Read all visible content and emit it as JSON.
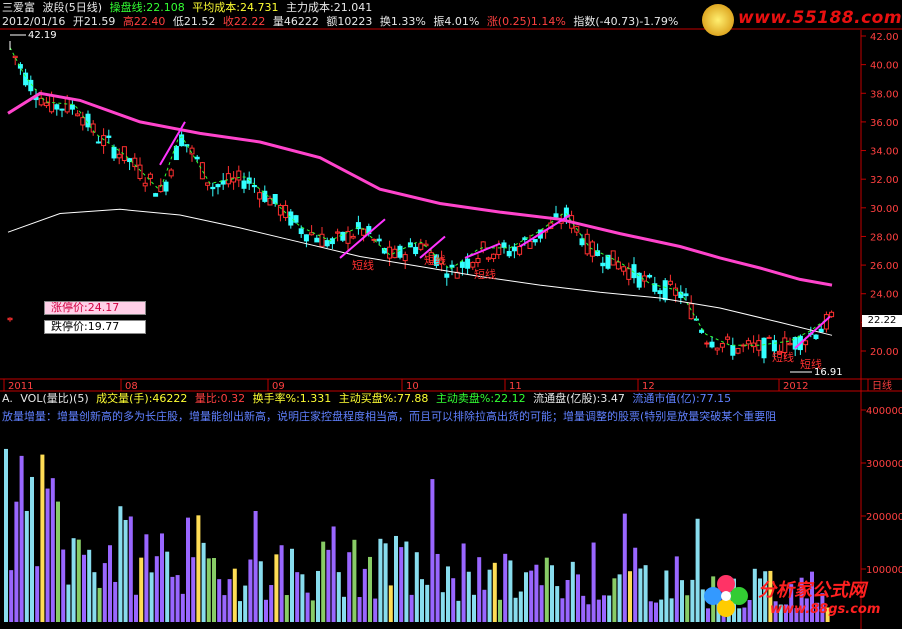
{
  "title_bar": {
    "stock_name": "三爱富",
    "indicator": "波段(5日线)",
    "turnover_line": "操盘线:22.108",
    "avg_cost": "平均成本:24.731",
    "main_cost": "主力成本:21.041"
  },
  "quote_bar": {
    "date": "2012/01/16",
    "open": "开21.59",
    "high": "高22.40",
    "low": "低21.52",
    "close": "收22.22",
    "volume": "量46222",
    "amount": "额10223",
    "turnover": "换1.33%",
    "amplitude": "振4.01%",
    "change": "涨(0.25)1.14%",
    "index": "指数(-40.73)-1.79%"
  },
  "price_axis": [
    "42.00",
    "40.00",
    "38.00",
    "36.00",
    "34.00",
    "32.00",
    "30.00",
    "28.00",
    "26.00",
    "24.00",
    "22.00",
    "20.00"
  ],
  "current_price": "22.22",
  "high_mark": "42.19",
  "low_mark": "16.91",
  "limit_up": "涨停价:24.17",
  "limit_down": "跌停价:19.77",
  "time_axis": [
    "2011",
    "08",
    "09",
    "10",
    "11",
    "12",
    "2012",
    "日线"
  ],
  "signal_label": "短线",
  "volume_bar": {
    "prefix": "A.",
    "name": "VOL(量比)(5)",
    "volume": "成交量(手):46222",
    "ratio": "量比:0.32",
    "turnover": "换手率%:1.331",
    "active_buy": "主动买盘%:77.88",
    "active_sell": "主动卖盘%:22.12",
    "float_cap": "流通盘(亿股):3.47",
    "float_value": "流通市值(亿):77.15"
  },
  "vol_comment": "放量增量：增量创新高的多为长庄股，增量能创出新高，说明庄家控盘程度相当高，而且可以排除拉高出货的可能；增量调整的股票(特别是放量突破某个重要阻",
  "volume_axis": [
    "400000",
    "300000",
    "200000",
    "100000"
  ],
  "watermark_top": "www.55188.com",
  "watermark_bottom": {
    "name": "分析家公式网",
    "site": "www.88gs.com"
  },
  "colors": {
    "up": "#ff3030",
    "down": "#33ffff",
    "avg_line": "#ff44cc",
    "slow_line": "#ffffff",
    "vol_violet": "#9966ff",
    "vol_yellow": "#ffdd55",
    "vol_green": "#88cc66"
  }
}
